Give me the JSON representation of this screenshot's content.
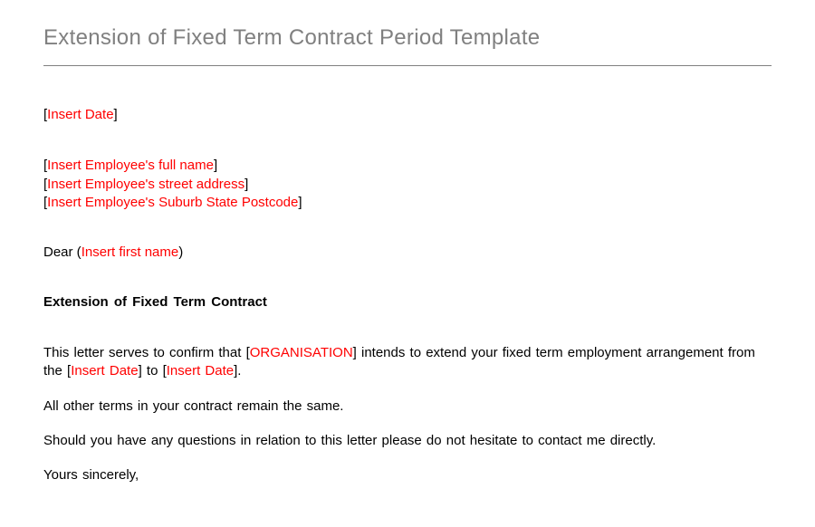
{
  "title": "Extension of Fixed Term Contract Period Template",
  "date_placeholder": "Insert Date",
  "employee": {
    "name_placeholder": "Insert Employee's full name",
    "street_placeholder": "Insert Employee's street address",
    "locality_placeholder": "Insert Employee's Suburb State Postcode"
  },
  "salutation_prefix": "Dear (",
  "salutation_placeholder": "Insert first name",
  "salutation_suffix": ")",
  "subject": "Extension  of Fixed Term Contract",
  "body": {
    "intro_before_org": "This letter serves to confirm that [",
    "org_placeholder": "ORGANISATION",
    "intro_after_org": "]  intends to extend your fixed term employment arrangement  from the [",
    "from_date_placeholder": "Insert Date",
    "between_dates": "] to [",
    "to_date_placeholder": "Insert Date",
    "after_dates": "].",
    "line2": "All other terms in your contract remain the same.",
    "line3": "Should you have any questions in relation to this letter please do not hesitate to contact me directly.",
    "closing": "Yours sincerely,"
  }
}
